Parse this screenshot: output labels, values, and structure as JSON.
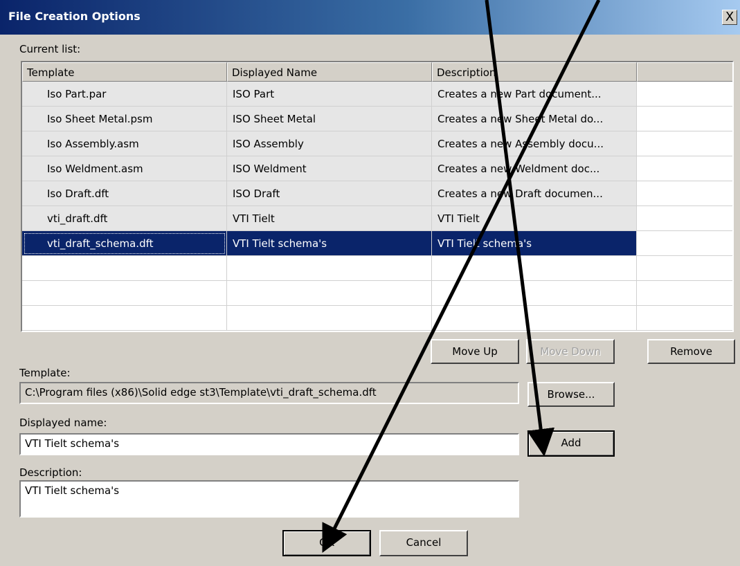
{
  "window": {
    "title": "File Creation Options",
    "close": "X"
  },
  "current_list_label": "Current list:",
  "columns": [
    "Template",
    "Displayed Name",
    "Description",
    ""
  ],
  "rows": [
    {
      "template": "Iso Part.par",
      "displayed": "ISO Part",
      "description": "Creates a new Part document..."
    },
    {
      "template": "Iso Sheet Metal.psm",
      "displayed": "ISO Sheet Metal",
      "description": "Creates a new Sheet Metal do..."
    },
    {
      "template": "Iso Assembly.asm",
      "displayed": "ISO Assembly",
      "description": "Creates a new Assembly docu..."
    },
    {
      "template": "Iso Weldment.asm",
      "displayed": "ISO Weldment",
      "description": "Creates a new Weldment doc..."
    },
    {
      "template": "Iso Draft.dft",
      "displayed": "ISO Draft",
      "description": "Creates a new Draft documen..."
    },
    {
      "template": "vti_draft.dft",
      "displayed": "VTI Tielt",
      "description": "VTI Tielt"
    },
    {
      "template": "vti_draft_schema.dft",
      "displayed": "VTI Tielt schema's",
      "description": "VTI Tielt schema's"
    }
  ],
  "buttons": {
    "move_up": "Move Up",
    "move_down": "Move Down",
    "remove": "Remove",
    "browse": "Browse...",
    "add": "Add",
    "ok": "OK",
    "cancel": "Cancel"
  },
  "template_label": "Template:",
  "template_value": "C:\\Program files (x86)\\Solid edge st3\\Template\\vti_draft_schema.dft",
  "displayed_name_label": "Displayed name:",
  "displayed_name_value": "VTI Tielt schema's",
  "description_label": "Description:",
  "description_value": "VTI Tielt schema's",
  "colors": {
    "selection": "#0a246a",
    "dialog": "#d4d0c8"
  }
}
